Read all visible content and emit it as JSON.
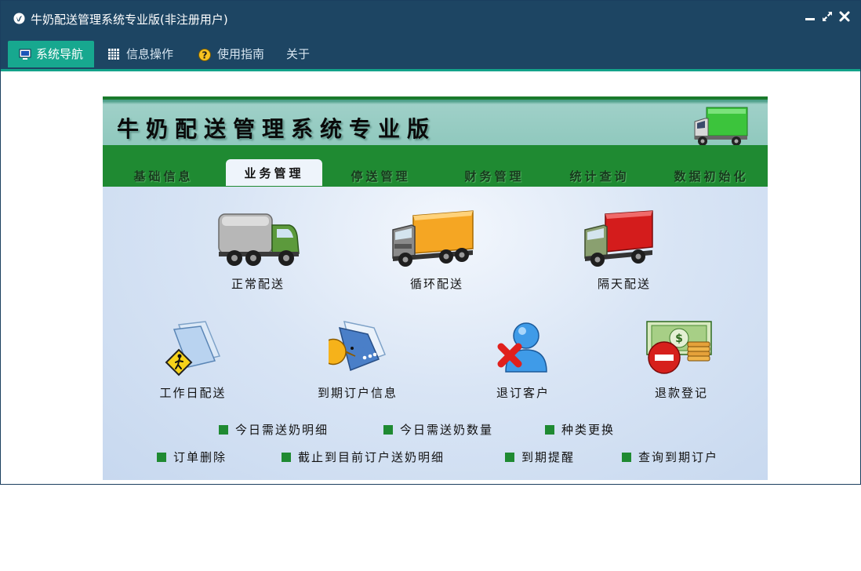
{
  "window": {
    "title": "牛奶配送管理系统专业版(非注册用户)"
  },
  "menu": [
    {
      "label": "系统导航",
      "icon": "monitor-icon",
      "active": true
    },
    {
      "label": "信息操作",
      "icon": "grid-icon",
      "active": false
    },
    {
      "label": "使用指南",
      "icon": "help-icon",
      "active": false
    },
    {
      "label": "关于",
      "icon": "",
      "active": false
    }
  ],
  "banner": {
    "title": "牛奶配送管理系统专业版"
  },
  "tabs": [
    "基础信息",
    "业务管理",
    "停送管理",
    "财务管理",
    "统计查询",
    "数据初始化"
  ],
  "active_tab": "业务管理",
  "business": [
    {
      "label": "正常配送",
      "icon": "gray-truck-icon"
    },
    {
      "label": "循环配送",
      "icon": "orange-truck-icon"
    },
    {
      "label": "隔天配送",
      "icon": "red-truck-icon"
    },
    {
      "label": "工作日配送",
      "icon": "worker-sign-icon"
    },
    {
      "label": "到期订户信息",
      "icon": "pacman-document-icon"
    },
    {
      "label": "退订客户",
      "icon": "user-remove-icon"
    },
    {
      "label": "退款登记",
      "icon": "money-refund-icon"
    }
  ],
  "links": [
    "今日需送奶明细",
    "今日需送奶数量",
    "种类更换",
    "订单删除",
    "截止到目前订户送奶明细",
    "到期提醒",
    "查询到期订户"
  ],
  "colors": {
    "titlebar": "#1d4563",
    "accent": "#17a88f",
    "tab_green": "#1f8a32"
  }
}
